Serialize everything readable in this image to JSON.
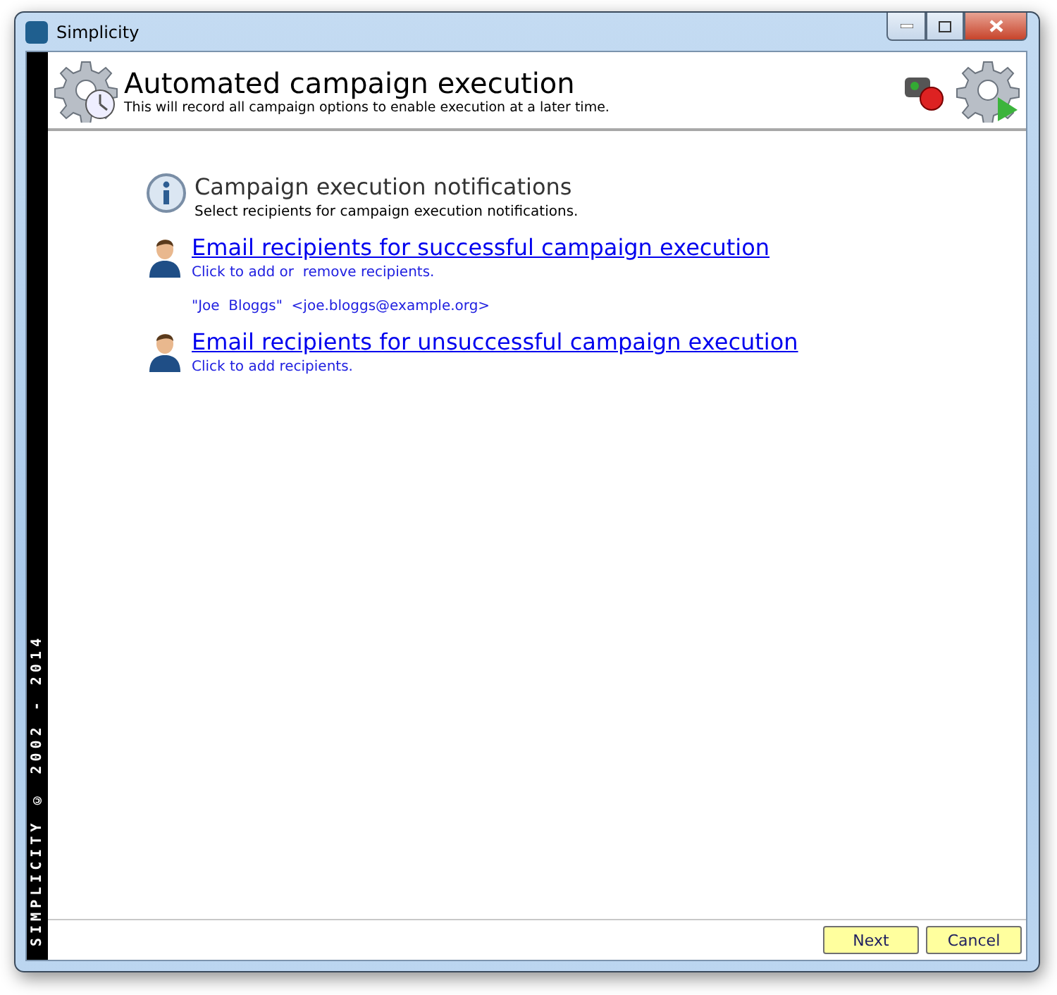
{
  "window": {
    "title": "Simplicity"
  },
  "header": {
    "title": "Automated campaign execution",
    "subtitle": "This will record all campaign options to enable execution at a later time."
  },
  "side_banner": "SIMPLICITY © 2002 - 2014",
  "notifications": {
    "heading": "Campaign execution notifications",
    "description": "Select recipients for campaign execution notifications."
  },
  "recipient_groups": [
    {
      "link": "Email recipients for successful campaign execution",
      "hint": "Click to add or  remove recipients.",
      "recipients": [
        "\"Joe  Bloggs\"  <joe.bloggs@example.org>"
      ]
    },
    {
      "link": "Email recipients for unsuccessful campaign execution",
      "hint": "Click to add recipients."
    }
  ],
  "buttons": [
    "Next",
    "Cancel"
  ]
}
